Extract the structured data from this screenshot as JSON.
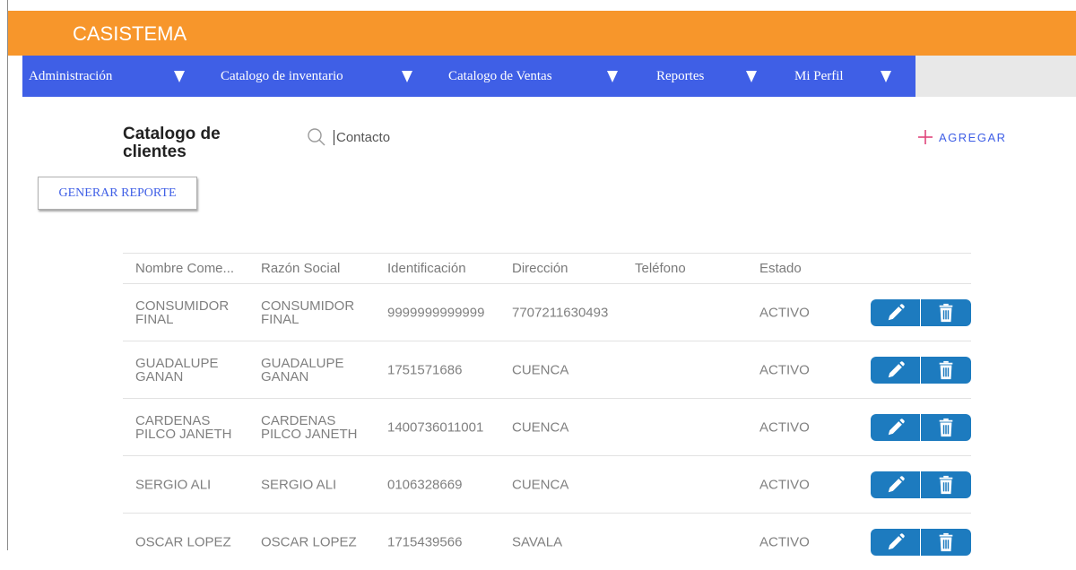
{
  "brand": "CASISTEMA",
  "nav": [
    {
      "label": "Administración"
    },
    {
      "label": "Catalogo de inventario"
    },
    {
      "label": "Catalogo de Ventas"
    },
    {
      "label": "Reportes"
    },
    {
      "label": "Mi Perfil"
    }
  ],
  "page_title": "Catalogo de clientes",
  "search": {
    "placeholder": "Contacto",
    "value": ""
  },
  "add_label": "AGREGAR",
  "report_label": "GENERAR REPORTE",
  "table": {
    "headers": [
      "Nombre Come...",
      "Razón Social",
      "Identificación",
      "Dirección",
      "Teléfono",
      "Estado"
    ],
    "rows": [
      {
        "nombre": "CONSUMIDOR FINAL",
        "razon": "CONSUMIDOR FINAL",
        "identificacion": "9999999999999",
        "direccion": "7707211630493",
        "telefono": "",
        "estado": "ACTIVO"
      },
      {
        "nombre": "GUADALUPE GANAN",
        "razon": "GUADALUPE GANAN",
        "identificacion": "1751571686",
        "direccion": "CUENCA",
        "telefono": "",
        "estado": "ACTIVO"
      },
      {
        "nombre": "CARDENAS PILCO JANETH",
        "razon": "CARDENAS PILCO JANETH",
        "identificacion": "1400736011001",
        "direccion": "CUENCA",
        "telefono": "",
        "estado": "ACTIVO"
      },
      {
        "nombre": "SERGIO ALI",
        "razon": "SERGIO ALI",
        "identificacion": "0106328669",
        "direccion": "CUENCA",
        "telefono": "",
        "estado": "ACTIVO"
      },
      {
        "nombre": "OSCAR LOPEZ",
        "razon": "OSCAR LOPEZ",
        "identificacion": "1715439566",
        "direccion": "SAVALA",
        "telefono": "",
        "estado": "ACTIVO"
      }
    ]
  },
  "icons": {
    "search": "search-icon",
    "add": "plus-icon",
    "caret": "caret-down-icon",
    "edit": "pencil-icon",
    "delete": "trash-icon"
  },
  "colors": {
    "topbar": "#f7962b",
    "nav": "#3f5fe6",
    "action": "#1d7bbf",
    "add_plus": "#e0457b",
    "link": "#3f5fe6"
  }
}
